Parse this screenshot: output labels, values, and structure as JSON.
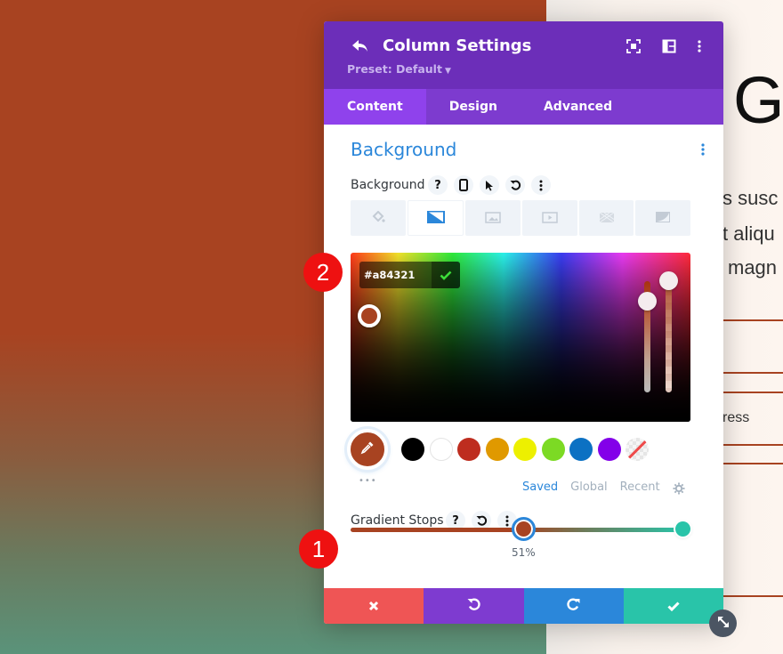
{
  "modal": {
    "title": "Column Settings",
    "preset_label": "Preset: Default",
    "tabs": [
      {
        "label": "Content",
        "active": true
      },
      {
        "label": "Design",
        "active": false
      },
      {
        "label": "Advanced",
        "active": false
      }
    ],
    "header_icons": [
      "back-icon",
      "focus-mode-icon",
      "sidebar-layout-icon",
      "more-options-icon"
    ]
  },
  "section": {
    "title": "Background"
  },
  "background_field": {
    "label": "Background",
    "action_icons": [
      "help-icon",
      "responsive-phone-icon",
      "hover-pointer-icon",
      "reset-icon",
      "more-icon"
    ],
    "type_tabs": [
      {
        "icon": "paint-bucket-icon",
        "active": false
      },
      {
        "icon": "gradient-icon",
        "active": true
      },
      {
        "icon": "image-icon",
        "active": false
      },
      {
        "icon": "video-icon",
        "active": false
      },
      {
        "icon": "pattern-icon",
        "active": false
      },
      {
        "icon": "mask-icon",
        "active": false
      }
    ]
  },
  "color_picker": {
    "hex_value": "#a84321",
    "current_color": "#a84321",
    "swatches": [
      "#000000",
      "#ffffff",
      "#be2d1f",
      "#e09900",
      "#edf000",
      "#7cda24",
      "#0c71c3",
      "#8300e9",
      "none"
    ],
    "palette_tabs": [
      {
        "label": "Saved",
        "active": true
      },
      {
        "label": "Global",
        "active": false
      },
      {
        "label": "Recent",
        "active": false
      }
    ],
    "more_dots": "•••"
  },
  "gradient_stops": {
    "label": "Gradient Stops",
    "stops": [
      {
        "color": "#a84321",
        "position_percent": 51
      },
      {
        "color": "#29c4a9",
        "position_percent": 100
      }
    ],
    "active_stop_label": "51%"
  },
  "footer": {
    "buttons": [
      {
        "name": "cancel",
        "color": "#ef5555"
      },
      {
        "name": "undo",
        "color": "#7e3bd0"
      },
      {
        "name": "redo",
        "color": "#2b87da"
      },
      {
        "name": "save",
        "color": "#29c4a9"
      }
    ]
  },
  "annotations": {
    "badge_1": "1",
    "badge_2": "2"
  },
  "page": {
    "heading_fragment": "G",
    "text_lines": [
      "s susc",
      "t aliqu",
      "magn"
    ],
    "small_text": "ress"
  }
}
